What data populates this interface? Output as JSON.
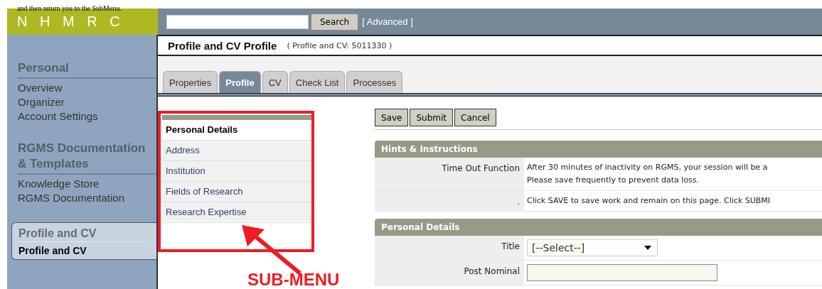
{
  "document_text": "and then return you to the SubMenu.",
  "logo": "N H M R C",
  "search": {
    "button": "Search",
    "advanced": "[ Advanced ]"
  },
  "sidebar": {
    "sections": [
      {
        "heading": "Personal",
        "items": [
          "Overview",
          "Organizer",
          "Account Settings"
        ]
      },
      {
        "heading": "RGMS Documentation & Templates",
        "items": [
          "Knowledge Store",
          "RGMS Documentation"
        ]
      }
    ],
    "active_section": {
      "heading": "Profile and CV",
      "items": [
        {
          "label": "Profile and CV",
          "selected": true
        }
      ]
    }
  },
  "page": {
    "title": "Profile and CV Profile",
    "subtitle": "( Profile and CV: 5011330 )"
  },
  "tabs": [
    {
      "label": "Properties",
      "selected": false
    },
    {
      "label": "Profile",
      "selected": true
    },
    {
      "label": "CV",
      "selected": false
    },
    {
      "label": "Check List",
      "selected": false
    },
    {
      "label": "Processes",
      "selected": false
    }
  ],
  "submenu": [
    {
      "label": "Personal Details",
      "selected": true
    },
    {
      "label": "Address",
      "selected": false
    },
    {
      "label": "Institution",
      "selected": false
    },
    {
      "label": "Fields of Research",
      "selected": false
    },
    {
      "label": "Research Expertise",
      "selected": false
    }
  ],
  "annotation": {
    "label": "SUB-MENU"
  },
  "buttons": [
    "Save",
    "Submit",
    "Cancel"
  ],
  "hints": {
    "heading": "Hints & Instructions",
    "rows": [
      {
        "label": "Time Out Function",
        "lines": [
          "After 30 minutes of inactivity on RGMS, your session will be a",
          "Please save frequently to prevent data loss."
        ]
      },
      {
        "label": ".",
        "lines": [
          "Click SAVE to save work and remain on this page. Click SUBMI"
        ]
      }
    ]
  },
  "personal_details": {
    "heading": "Personal Details",
    "fields": [
      {
        "kind": "select",
        "label": "Title",
        "value": "[--Select--]"
      },
      {
        "kind": "text",
        "label": "Post Nominal"
      }
    ]
  }
}
